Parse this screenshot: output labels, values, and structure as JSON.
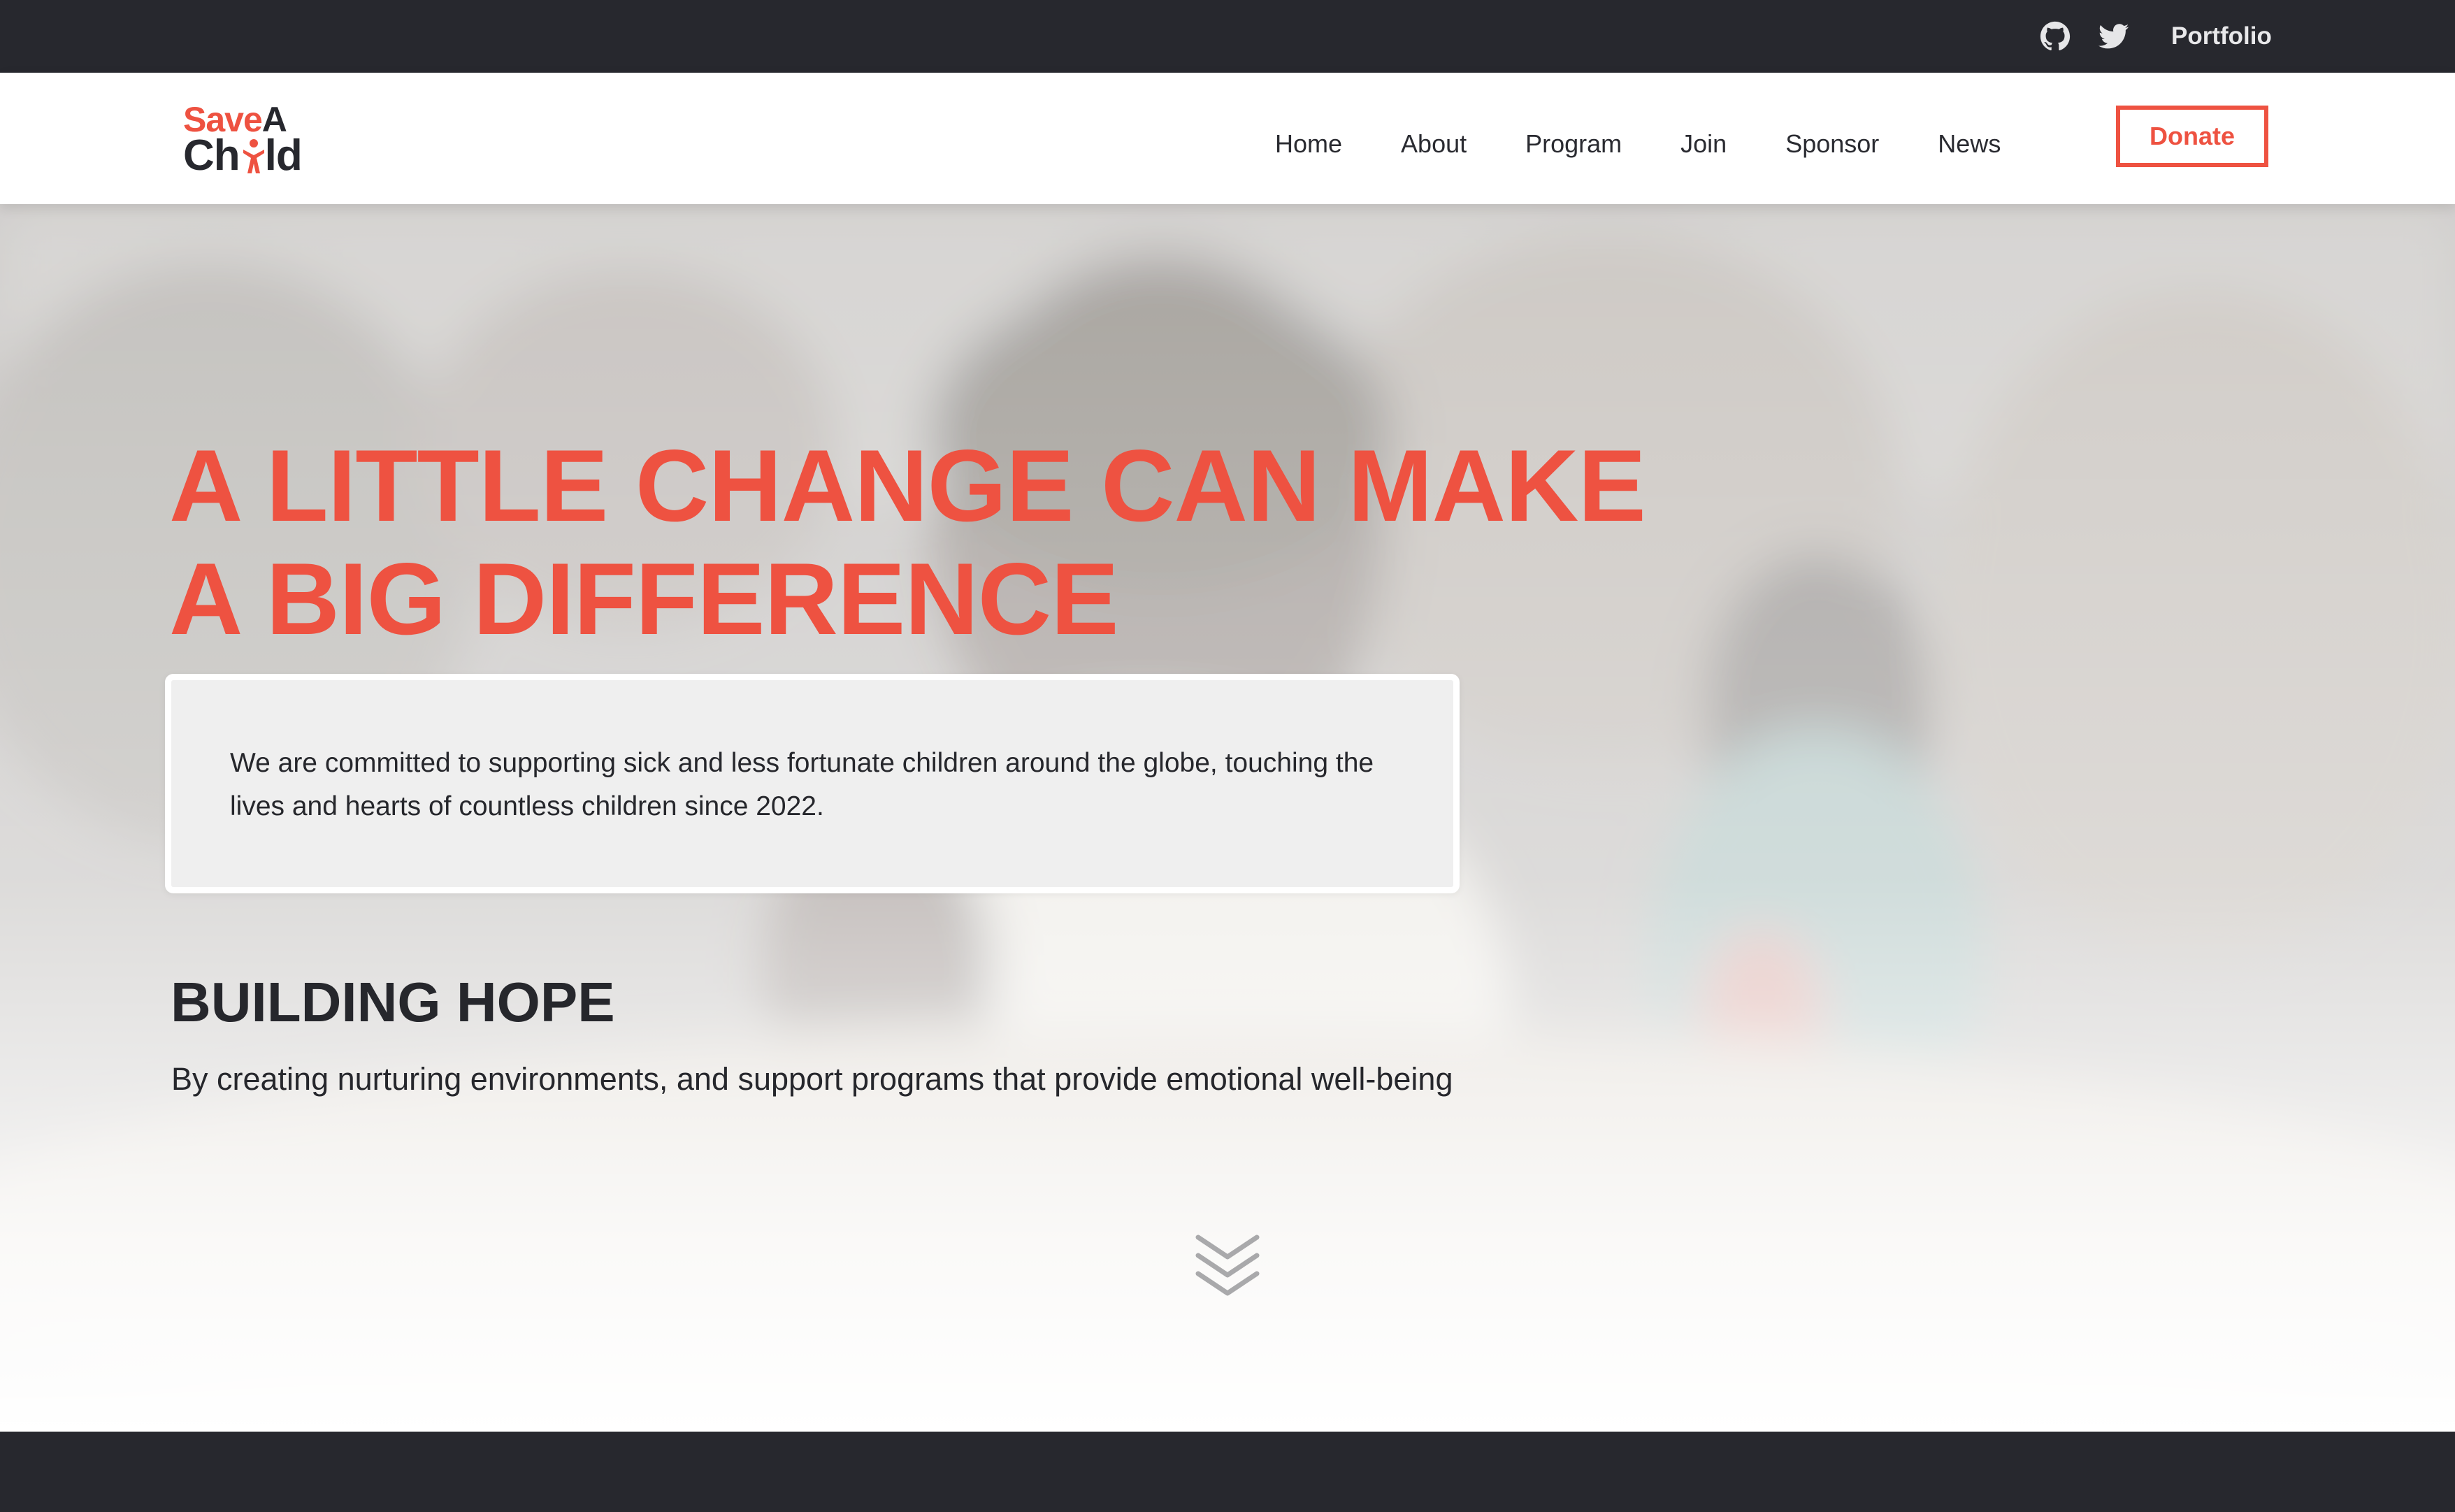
{
  "topbar": {
    "portfolio_label": "Portfolio",
    "icons": [
      "github-icon",
      "twitter-icon"
    ]
  },
  "brand": {
    "name_line1_part1": "Save",
    "name_line1_part2": "A",
    "name_line2_part1": "Ch",
    "name_line2_part2": "ld",
    "accent_color": "#ee5241",
    "dark_color": "#27282e"
  },
  "nav": {
    "items": [
      {
        "label": "Home"
      },
      {
        "label": "About"
      },
      {
        "label": "Program"
      },
      {
        "label": "Join"
      },
      {
        "label": "Sponsor"
      },
      {
        "label": "News"
      }
    ],
    "donate_label": "Donate"
  },
  "hero": {
    "title_line1": "A LITTLE CHANGE CAN MAKE",
    "title_line2": "A BIG DIFFERENCE",
    "mission": "We are committed to supporting sick and less fortunate children around the globe, touching the lives and hearts of countless children since 2022.",
    "section_title": "BUILDING HOPE",
    "section_text": "By creating nurturing environments, and support programs that provide emotional well-being",
    "scroll_icon": "double-chevron-down-icon"
  }
}
